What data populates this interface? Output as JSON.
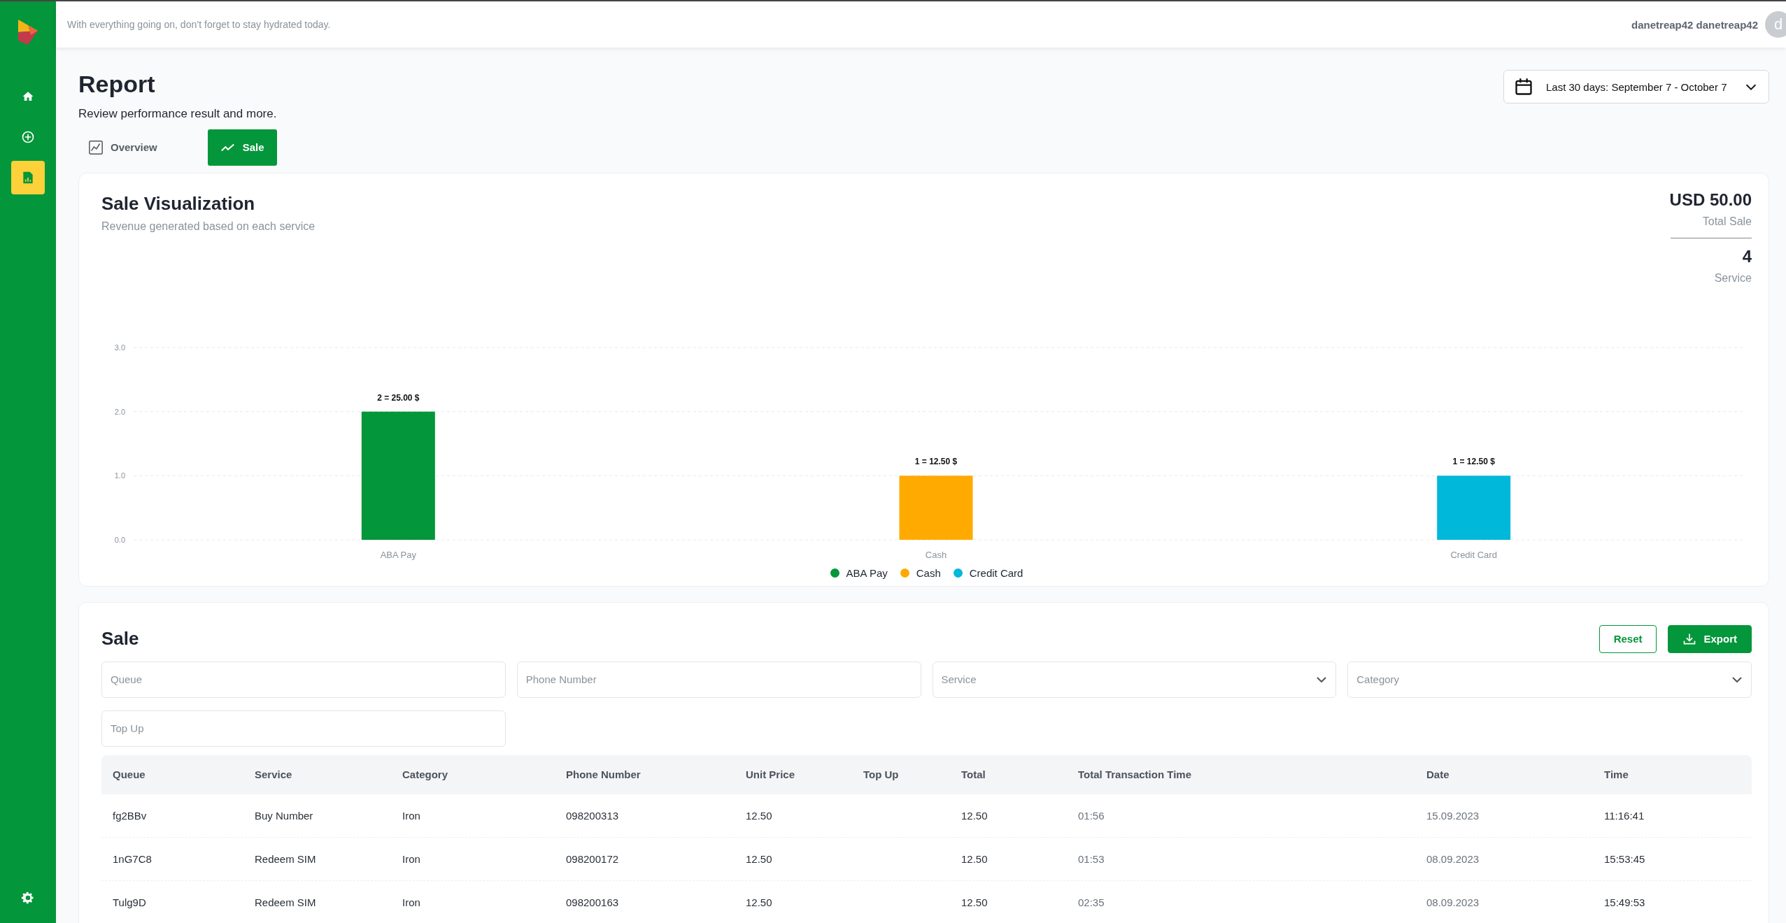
{
  "header": {
    "message": "With everything going on, don’t forget to stay hydrated today.",
    "user_name": "danetreap42 danetreap42",
    "avatar_letter": "d"
  },
  "sidebar": {
    "items": [
      {
        "kind": "home",
        "selected": false
      },
      {
        "kind": "add",
        "selected": false
      },
      {
        "kind": "report",
        "selected": true
      }
    ],
    "bottom_item": {
      "kind": "settings",
      "selected": false
    }
  },
  "page": {
    "title": "Report",
    "subtitle": "Review performance result and more.",
    "date_range": "Last 30 days: September 7 - October 7"
  },
  "tabs": [
    {
      "label": "Overview",
      "kind": "overview",
      "selected": false
    },
    {
      "label": "Sale",
      "kind": "sale",
      "selected": true
    }
  ],
  "visualization": {
    "title": "Sale Visualization",
    "subtitle": "Revenue generated based on each service",
    "total_value": "USD 50.00",
    "total_label": "Total Sale",
    "service_count": "4",
    "service_label": "Service",
    "chart_data": {
      "type": "bar",
      "categories": [
        "ABA Pay",
        "Cash",
        "Credit Card"
      ],
      "stacked": true,
      "ylim": [
        0,
        3
      ],
      "yticks": [
        {
          "value": 0,
          "label": "0.0"
        },
        {
          "value": 1,
          "label": "1.0"
        },
        {
          "value": 2,
          "label": "2.0"
        },
        {
          "value": 3,
          "label": "3.0"
        }
      ],
      "series": [
        {
          "name": "ABA Pay",
          "color": "#03963a",
          "values": [
            2,
            null,
            null
          ]
        },
        {
          "name": "Cash",
          "color": "#ffaa00",
          "values": [
            null,
            1,
            null
          ]
        },
        {
          "name": "Credit Card",
          "color": "#00b8d9",
          "values": [
            null,
            null,
            1
          ]
        }
      ],
      "legend": "bottom",
      "value_labels": [
        "2 = 25.00 $",
        "1 = 12.50 $",
        "1 = 12.50 $"
      ]
    }
  },
  "sale": {
    "title": "Sale",
    "buttons": [
      {
        "label": "Reset",
        "kind": "outline"
      },
      {
        "label": "Export",
        "kind": "export"
      }
    ],
    "filters": [
      {
        "placeholder": "Queue",
        "kind": "text"
      },
      {
        "placeholder": "Phone Number",
        "kind": "text"
      },
      {
        "placeholder": "Service",
        "kind": "select"
      },
      {
        "placeholder": "Category",
        "kind": "select"
      },
      {
        "placeholder": "Top Up",
        "kind": "text"
      }
    ],
    "table": {
      "columns": [
        "Queue",
        "Service",
        "Category",
        "Phone Number",
        "Unit Price",
        "Top Up",
        "Total",
        "Total Transaction Time",
        "Date",
        "Time"
      ],
      "rows": [
        [
          "fg2BBv",
          "Buy Number",
          "Iron",
          "098200313",
          "12.50",
          "",
          "12.50",
          "01:56",
          "15.09.2023",
          "11:16:41"
        ],
        [
          "1nG7C8",
          "Redeem SIM",
          "Iron",
          "098200172",
          "12.50",
          "",
          "12.50",
          "01:53",
          "08.09.2023",
          "15:53:45"
        ],
        [
          "Tulg9D",
          "Redeem SIM",
          "Iron",
          "098200163",
          "12.50",
          "",
          "12.50",
          "02:35",
          "08.09.2023",
          "15:49:53"
        ]
      ]
    }
  }
}
